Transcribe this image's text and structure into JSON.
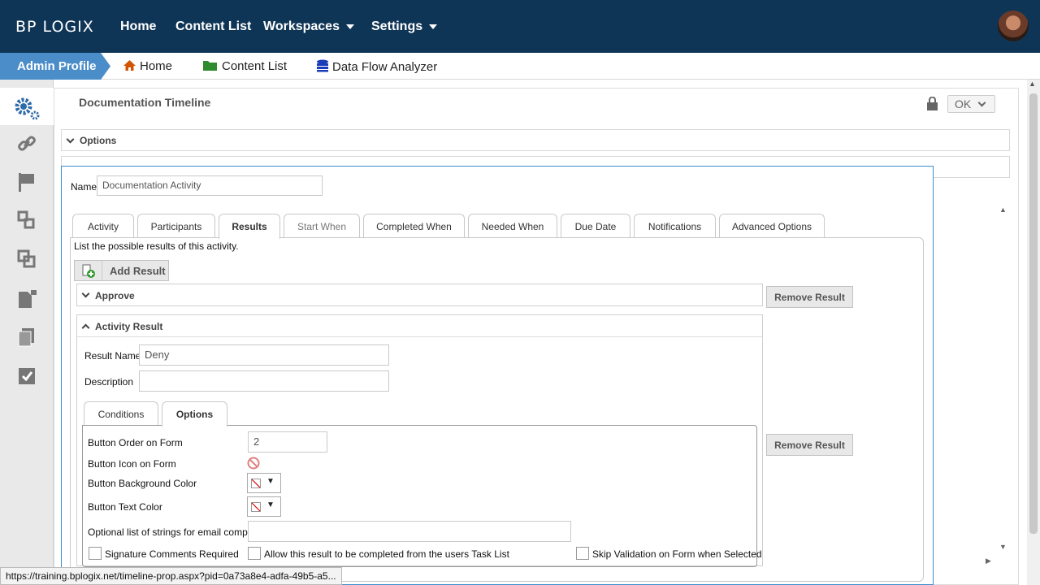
{
  "topnav": {
    "logo": "BP LOGIX",
    "items": [
      "Home",
      "Content List",
      "Workspaces",
      "Settings"
    ]
  },
  "subnav": {
    "admin": "Admin Profile",
    "items": [
      "Home",
      "Content List",
      "Data Flow Analyzer"
    ]
  },
  "page": {
    "title": "Documentation Timeline",
    "ok_label": "OK",
    "options_label": "Options"
  },
  "dialog": {
    "name_label": "Name",
    "name_value": "Documentation Activity",
    "tabs": [
      "Activity",
      "Participants",
      "Results",
      "Start When",
      "Completed When",
      "Needed When",
      "Due Date",
      "Notifications",
      "Advanced Options"
    ],
    "intro": "List the possible results of this activity.",
    "add_result": "Add Result",
    "approve": "Approve",
    "remove_result": "Remove Result",
    "activity_result": "Activity Result",
    "result_name_label": "Result Name",
    "result_name_value": "Deny",
    "description_label": "Description",
    "subtabs": [
      "Conditions",
      "Options"
    ],
    "opts": {
      "order_label": "Button Order on Form",
      "order_value": "2",
      "icon_label": "Button Icon on Form",
      "bg_label": "Button Background Color",
      "text_label": "Button Text Color",
      "email_label": "Optional list of strings for email complete",
      "sig_label": "Signature Comments Required",
      "tasklist_label": "Allow this result to be completed from the users Task List",
      "skip_label": "Skip Validation on Form when Selected"
    }
  },
  "status": "https://training.bplogix.net/timeline-prop.aspx?pid=0a73a8e4-adfa-49b5-a5..."
}
